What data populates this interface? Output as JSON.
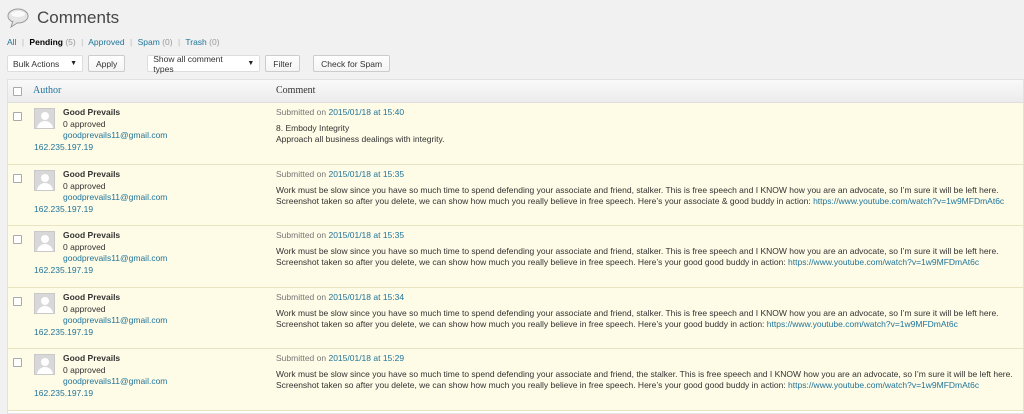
{
  "page": {
    "title": "Comments",
    "icon": "comment-bubble-icon"
  },
  "filters": [
    {
      "label": "All",
      "count": "",
      "current": false
    },
    {
      "label": "Pending",
      "count": "(5)",
      "current": true
    },
    {
      "label": "Approved",
      "count": "",
      "current": false
    },
    {
      "label": "Spam",
      "count": "(0)",
      "current": false
    },
    {
      "label": "Trash",
      "count": "(0)",
      "current": false
    }
  ],
  "toolbar": {
    "bulk_actions": "Bulk Actions",
    "apply": "Apply",
    "comment_types": "Show all comment types",
    "filter": "Filter",
    "check_spam": "Check for Spam"
  },
  "table": {
    "col_author": "Author",
    "col_comment": "Comment"
  },
  "comments": [
    {
      "author": "Good Prevails",
      "approved": "0 approved",
      "email": "goodprevails11@gmail.com",
      "ip": "162.235.197.19",
      "submitted_prefix": "Submitted on",
      "submitted_date": "2015/01/18 at 15:40",
      "line1": "8. Embody Integrity",
      "line2": "Approach all business dealings with integrity.",
      "link": ""
    },
    {
      "author": "Good Prevails",
      "approved": "0 approved",
      "email": "goodprevails11@gmail.com",
      "ip": "162.235.197.19",
      "submitted_prefix": "Submitted on",
      "submitted_date": "2015/01/18 at 15:35",
      "line1": "Work must be slow since you have so much time to spend defending your associate and friend, stalker. This is free speech and I KNOW how you are an advocate, so I’m sure it will be left here.",
      "line2": "Screenshot taken so after you delete, we can show how much you really believe in free speech. Here’s your associate & good buddy in action: ",
      "link": "https://www.youtube.com/watch?v=1w9MFDmAt6c"
    },
    {
      "author": "Good Prevails",
      "approved": "0 approved",
      "email": "goodprevails11@gmail.com",
      "ip": "162.235.197.19",
      "submitted_prefix": "Submitted on",
      "submitted_date": "2015/01/18 at 15:35",
      "line1": "Work must be slow since you have so much time to spend defending your associate and friend, stalker. This is free speech and I KNOW how you are an advocate, so I’m sure it will be left here.",
      "line2": "Screenshot taken so after you delete, we can show how much you really believe in free speech. Here’s your good good buddy in action: ",
      "link": "https://www.youtube.com/watch?v=1w9MFDmAt6c"
    },
    {
      "author": "Good Prevails",
      "approved": "0 approved",
      "email": "goodprevails11@gmail.com",
      "ip": "162.235.197.19",
      "submitted_prefix": "Submitted on",
      "submitted_date": "2015/01/18 at 15:34",
      "line1": "Work must be slow since you have so much time to spend defending your associate and friend, stalker. This is free speech and I KNOW how you are an advocate, so I’m sure it will be left here.",
      "line2": "Screenshot taken so after you delete, we can show how much you really believe in free speech. Here’s your good buddy in action: ",
      "link": "https://www.youtube.com/watch?v=1w9MFDmAt6c"
    },
    {
      "author": "Good Prevails",
      "approved": "0 approved",
      "email": "goodprevails11@gmail.com",
      "ip": "162.235.197.19",
      "submitted_prefix": "Submitted on",
      "submitted_date": "2015/01/18 at 15:29",
      "line1": "Work must be slow since you have so much time to spend defending your associate and friend, the stalker. This is free speech and I KNOW how you are an advocate, so I’m sure it will be left here.",
      "line2": "Screenshot taken so after you delete, we can show how much you really believe in free speech. Here’s your good good buddy in action: ",
      "link": "https://www.youtube.com/watch?v=1w9MFDmAt6c"
    }
  ]
}
